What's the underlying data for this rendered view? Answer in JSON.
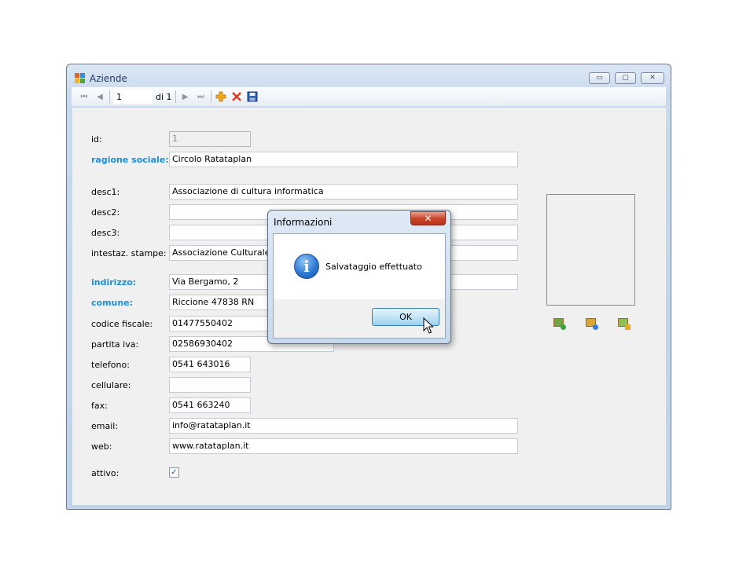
{
  "window": {
    "title": "Aziende",
    "controls": {
      "minimize": "▭",
      "maximize": "▢",
      "close": "✕"
    }
  },
  "navigator": {
    "position": "1",
    "count_label": "di 1"
  },
  "form": {
    "fields": [
      {
        "label": "id:",
        "value": "1",
        "required": false,
        "disabled": true
      },
      {
        "label": "ragione sociale:",
        "value": "Circolo Ratataplan",
        "required": true
      },
      {
        "label": "desc1:",
        "value": "Associazione di cultura informatica",
        "required": false
      },
      {
        "label": "desc2:",
        "value": "",
        "required": false
      },
      {
        "label": "desc3:",
        "value": "",
        "required": false
      },
      {
        "label": "intestaz. stampe:",
        "value": "Associazione Culturale Ra",
        "required": false
      },
      {
        "label": "indirizzo:",
        "value": "Via Bergamo, 2",
        "required": true
      },
      {
        "label": "comune:",
        "value": "Riccione 47838 RN",
        "required": true
      },
      {
        "label": "codice fiscale:",
        "value": "01477550402",
        "required": false
      },
      {
        "label": "partita iva:",
        "value": "02586930402",
        "required": false
      },
      {
        "label": "telefono:",
        "value": "0541 643016",
        "required": false
      },
      {
        "label": "cellulare:",
        "value": "",
        "required": false
      },
      {
        "label": "fax:",
        "value": "0541 663240",
        "required": false
      },
      {
        "label": "email:",
        "value": "info@ratataplan.it",
        "required": false
      },
      {
        "label": "web:",
        "value": "www.ratataplan.it",
        "required": false
      }
    ],
    "active": {
      "label": "attivo:",
      "checked": true
    }
  },
  "dialog": {
    "title": "Informazioni",
    "close": "✕",
    "message": "Salvataggio effettuato",
    "ok_label": "OK",
    "icon": "info-icon"
  },
  "colors": {
    "required_label": "#1c8fdb",
    "delete": "#e03a1e",
    "add": "#f0a81c"
  }
}
